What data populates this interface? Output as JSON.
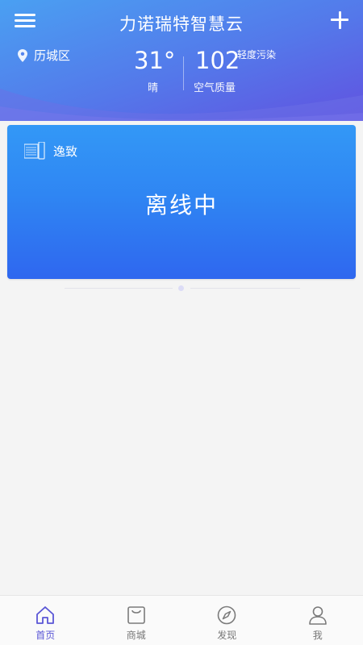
{
  "header": {
    "title": "力诺瑞特智慧云",
    "location": "历城区",
    "temperature": "31°",
    "weather": "晴",
    "aqi_value": "102",
    "aqi_level": "轻度污染",
    "aqi_label": "空气质量"
  },
  "device": {
    "name": "逸致",
    "status": "离线中"
  },
  "nav": {
    "items": [
      {
        "label": "首页",
        "icon": "home-icon",
        "active": true
      },
      {
        "label": "商城",
        "icon": "shop-bag-icon",
        "active": false
      },
      {
        "label": "发现",
        "icon": "compass-icon",
        "active": false
      },
      {
        "label": "我",
        "icon": "user-icon",
        "active": false
      }
    ]
  },
  "colors": {
    "header_start": "#4a93f0",
    "header_end": "#5b5fe3",
    "card_top": "#3398f6",
    "card_bottom": "#2f67ef",
    "nav_active": "#5a56d6",
    "nav_inactive": "#777777"
  }
}
